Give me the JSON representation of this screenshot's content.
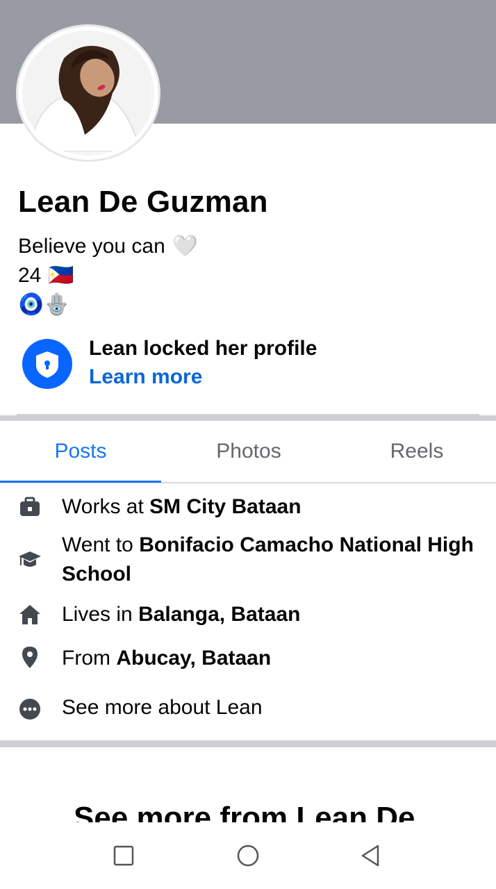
{
  "profile": {
    "name": "Lean De Guzman",
    "bio_line1": "Believe you can",
    "bio_line1_emoji": "🤍",
    "bio_line2": "24",
    "bio_line2_emoji": "🇵🇭",
    "bio_line3_emoji1": "🧿",
    "bio_line3_emoji2": "🪬"
  },
  "lock_notice": {
    "title": "Lean locked her profile",
    "link": "Learn more",
    "icon": "shield-lock-icon"
  },
  "tabs": [
    {
      "label": "Posts",
      "active": true
    },
    {
      "label": "Photos",
      "active": false
    },
    {
      "label": "Reels",
      "active": false
    }
  ],
  "about": {
    "work_prefix": "Works at",
    "work_place": "SM City Bataan",
    "school_prefix": "Went to",
    "school_name": "Bonifacio Camacho National High School",
    "lives_prefix": "Lives in",
    "lives_place": "Balanga, Bataan",
    "from_prefix": "From",
    "from_place": "Abucay, Bataan",
    "see_more": "See more about Lean"
  },
  "see_more_heading": "See more from Lean De",
  "colors": {
    "accent": "#1877f2",
    "link": "#0a66d8",
    "cover": "#989ba1"
  },
  "icons": {
    "work": "briefcase-icon",
    "school": "graduation-cap-icon",
    "home": "house-icon",
    "from": "location-pin-icon",
    "more": "more-dots-icon"
  }
}
